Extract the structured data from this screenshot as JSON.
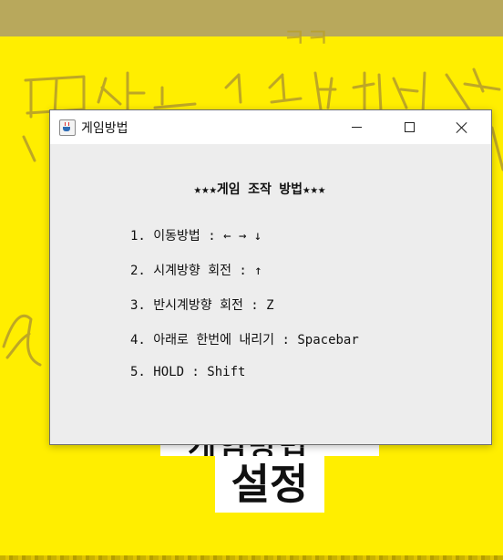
{
  "window": {
    "title": "게임방법",
    "icon": "java-coffee-icon",
    "controls": {
      "minimize": "minimize-icon",
      "maximize": "maximize-icon",
      "close": "close-icon"
    }
  },
  "content": {
    "heading": "★★★게임 조작 방법★★★",
    "instructions": [
      "1. 이동방법 : ← → ↓",
      "2. 시계방향 회전 : ↑",
      "3. 반시계방향 회전 : Z",
      "4. 아래로 한번에 내리기 : Spacebar",
      "5. HOLD : Shift"
    ]
  },
  "background": {
    "scribble_text": "ㅋㅋ",
    "settings_label": "설정",
    "partial_label": "게임방법",
    "colors": {
      "background": "#ffee00",
      "top_strip": "#b8a85c",
      "scribble": "#b8a02a"
    }
  }
}
